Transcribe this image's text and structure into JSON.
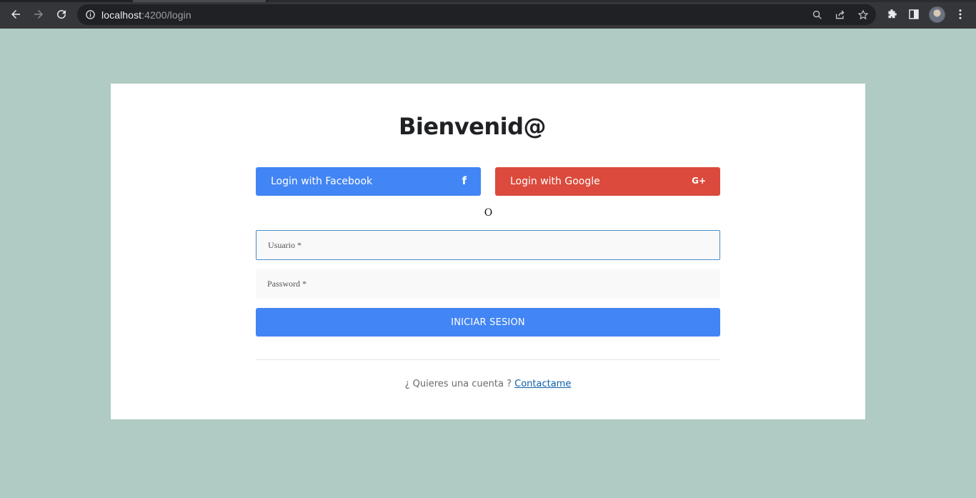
{
  "browser": {
    "url_host": "localhost",
    "url_rest": ":4200/login",
    "icons": [
      "back-arrow-icon",
      "forward-arrow-icon",
      "reload-icon",
      "site-info-icon",
      "zoom-icon",
      "share-icon",
      "star-icon",
      "extensions-icon",
      "side-panel-icon",
      "profile-avatar",
      "more-menu-icon"
    ]
  },
  "login": {
    "title": "Bienvenid@",
    "facebook_label": "Login with Facebook",
    "facebook_icon": "f",
    "google_label": "Login with Google",
    "google_icon": "G+",
    "separator": "O",
    "username_placeholder": "Usuario *",
    "password_placeholder": "Password *",
    "submit_label": "INICIAR SESION",
    "footer_text": "¿ Quieres una cuenta ? ",
    "footer_link": "Contactame"
  },
  "colors": {
    "page_bg": "#afcbc3",
    "facebook": "#4285f4",
    "google": "#db4a3c",
    "primary": "#4285f4",
    "link": "#0b5ea8"
  }
}
